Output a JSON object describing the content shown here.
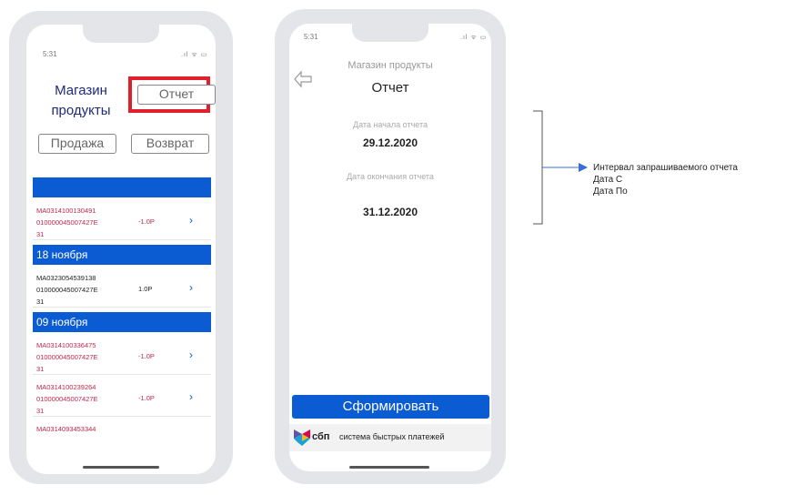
{
  "phone1": {
    "time": "5:31",
    "status_icons": ".ıl ᯤ ▭",
    "store_title": "Магазин\nпродукты",
    "report_button": "Отчет",
    "sale_button": "Продажа",
    "return_button": "Возврат",
    "highlight_color": "#e0202a",
    "groups": [
      {
        "date": "",
        "rows": [
          {
            "code": "МА0314100130491\n010000045007427Е\n31",
            "amount": "-1.0Р",
            "negative": true
          }
        ]
      },
      {
        "date": "18 ноября",
        "rows": [
          {
            "code": "МА0323054539138\n010000045007427Е\n31",
            "amount": "1.0Р",
            "negative": false
          }
        ]
      },
      {
        "date": "09 ноября",
        "rows": [
          {
            "code": "МА0314100336475\n010000045007427Е\n31",
            "amount": "-1.0Р",
            "negative": true
          },
          {
            "code": "МА0314100239264\n010000045007427Е\n31",
            "amount": "-1.0Р",
            "negative": true
          },
          {
            "code": "МА0314093453344",
            "amount": "",
            "negative": true
          }
        ]
      }
    ]
  },
  "phone2": {
    "time": "5:31",
    "status_icons": ".ıl ᯤ ▭",
    "back_icon": "back-arrow-icon",
    "store_name": "Магазин продукты",
    "title": "Отчет",
    "start_label": "Дата начала отчета",
    "start_date": "29.12.2020",
    "end_label": "Дата окончания отчета",
    "end_date": "31.12.2020",
    "generate_button": "Сформировать",
    "sbp_short": "сбп",
    "sbp_full": "система быстрых платежей"
  },
  "annotation": {
    "line1": "Интервал запрашиваемого отчета",
    "line2": "Дата С",
    "line3": "Дата По"
  },
  "colors": {
    "accent": "#0b5bd3",
    "negative": "#c2264a",
    "frame": "#e3e5e9"
  }
}
